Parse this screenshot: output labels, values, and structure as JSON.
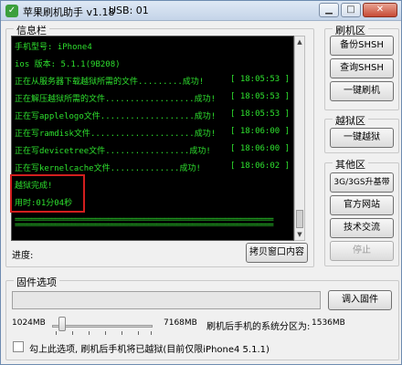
{
  "window": {
    "title": "苹果刷机助手 v1.18",
    "usb": "USB: 01",
    "icon": "app-icon"
  },
  "info": {
    "label": "信息栏",
    "lines": [
      {
        "text": "手机型号: iPhone4"
      },
      {
        "text": "ios 版本: 5.1.1(9B208)"
      },
      {
        "text": "正在从服务器下载越狱所需的文件",
        "status": "成功!",
        "time": "[ 18:05:53 ]"
      },
      {
        "text": "正在解压越狱所需的文件",
        "status": "成功!",
        "time": "[ 18:05:53 ]"
      },
      {
        "text": "正在写applelogo文件",
        "status": "成功!",
        "time": "[ 18:05:53 ]"
      },
      {
        "text": "正在写ramdisk文件",
        "status": "成功!",
        "time": "[ 18:06:00 ]"
      },
      {
        "text": "正在写devicetree文件",
        "status": "成功!",
        "time": "[ 18:06:00 ]"
      },
      {
        "text": "正在写kernelcache文件",
        "status": "成功!",
        "time": "[ 18:06:02 ]"
      },
      {
        "text": "越狱完成!"
      },
      {
        "text": "用时:01分04秒"
      }
    ],
    "separator": "================================================================",
    "progress_label": "进度:",
    "copy_button": "拷贝窗口内容"
  },
  "flash_group": {
    "label": "刷机区",
    "backup": "备份SHSH",
    "query": "查询SHSH",
    "one_click": "一键刷机"
  },
  "jailbreak_group": {
    "label": "越狱区",
    "one_click": "一键越狱"
  },
  "other_group": {
    "label": "其他区",
    "upgrade": "3G/3GS升基带",
    "website": "官方网站",
    "forum": "技术交流",
    "stop": "停止"
  },
  "firmware": {
    "label": "固件选项",
    "import_button": "调入固件",
    "min": "1024MB",
    "max": "7168MB",
    "partition_label": "刷机后手机的系统分区为:",
    "partition_value": "1536MB",
    "checkbox_label": "勾上此选项, 刷机后手机将已越狱(目前仅限iPhone4 5.1.1)"
  }
}
